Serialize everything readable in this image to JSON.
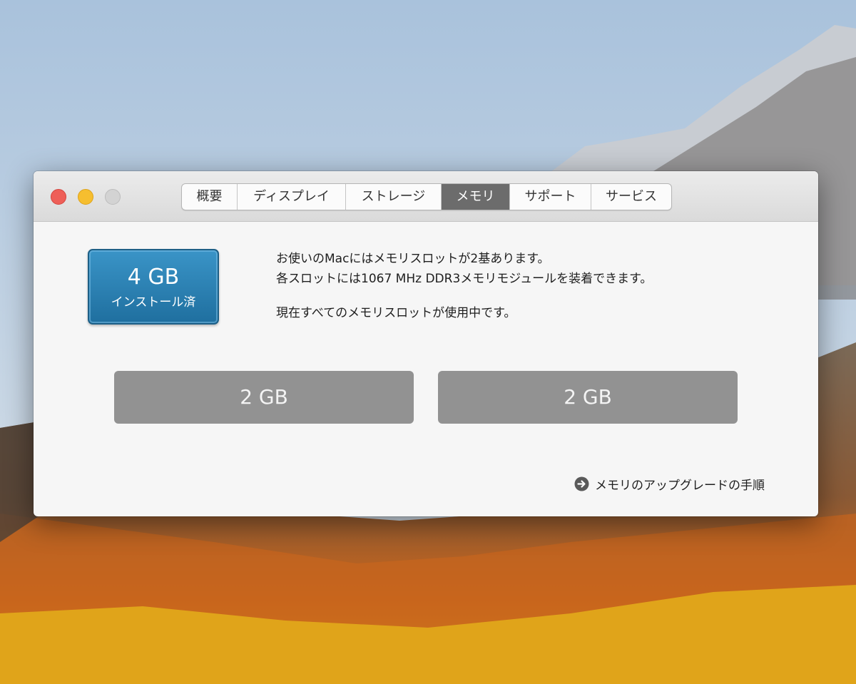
{
  "window": {
    "tabs": [
      {
        "label": "概要",
        "active": false
      },
      {
        "label": "ディスプレイ",
        "active": false
      },
      {
        "label": "ストレージ",
        "active": false
      },
      {
        "label": "メモリ",
        "active": true
      },
      {
        "label": "サポート",
        "active": false
      },
      {
        "label": "サービス",
        "active": false
      }
    ]
  },
  "memory": {
    "installed_size": "4 GB",
    "installed_label": "インストール済",
    "info_line_1": "お使いのMacにはメモリスロットが2基あります。",
    "info_line_2": "各スロットには1067 MHz DDR3メモリモジュールを装着できます。",
    "info_line_3": "現在すべてのメモリスロットが使用中です。",
    "slots": [
      {
        "label": "2 GB"
      },
      {
        "label": "2 GB"
      }
    ],
    "upgrade_link": "メモリのアップグレードの手順"
  },
  "icons": {
    "upgrade_link_icon": "arrow-circle-right-icon"
  },
  "colors": {
    "badge_blue": "#2a80b3",
    "active_tab": "#6c6c6c",
    "slot_gray": "#929292",
    "close": "#ee5f58",
    "minimize": "#f6be2f",
    "zoom_disabled": "#d3d3d3"
  }
}
